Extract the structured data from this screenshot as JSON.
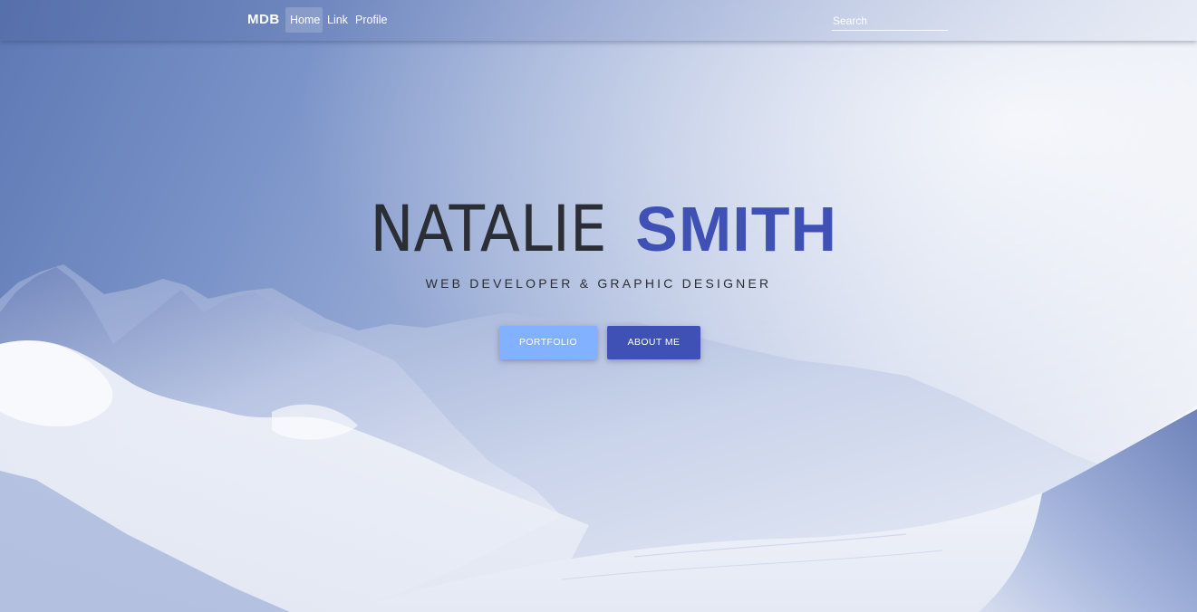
{
  "navbar": {
    "brand": "MDB",
    "items": [
      {
        "label": "Home",
        "active": true
      },
      {
        "label": "Link",
        "active": false
      },
      {
        "label": "Profile",
        "active": false
      }
    ],
    "search": {
      "placeholder": "Search",
      "value": ""
    }
  },
  "hero": {
    "name_first": "NATALIE",
    "name_last": "SMITH",
    "subtitle": "WEB DEVELOPER & GRAPHIC DESIGNER",
    "buttons": {
      "portfolio": "PORTFOLIO",
      "about": "ABOUT ME"
    }
  },
  "colors": {
    "accent": "#3f51b5",
    "portfolio_button": "#82b1ff",
    "about_button": "#3f51b5",
    "text_dark": "#2b2e35"
  }
}
